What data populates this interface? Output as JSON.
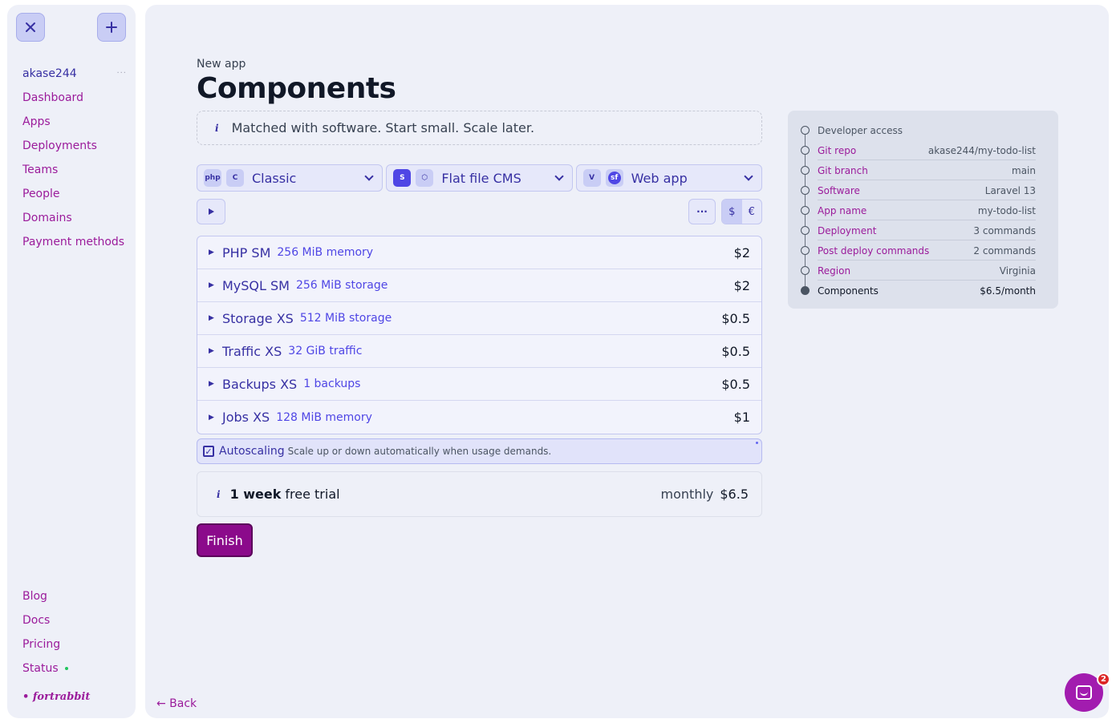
{
  "sidebar": {
    "user": "akase244",
    "user_menu": "···",
    "nav": [
      {
        "label": "Dashboard"
      },
      {
        "label": "Apps"
      },
      {
        "label": "Deployments"
      },
      {
        "label": "Teams"
      },
      {
        "label": "People"
      },
      {
        "label": "Domains"
      },
      {
        "label": "Payment methods"
      }
    ],
    "footer_links": [
      {
        "label": "Blog"
      },
      {
        "label": "Docs"
      },
      {
        "label": "Pricing"
      },
      {
        "label": "Status"
      }
    ],
    "brand": "• fortrabbit",
    "status_color": "#22c55e"
  },
  "header": {
    "breadcrumb": "New app",
    "title": "Components"
  },
  "info": {
    "icon": "i",
    "text": "Matched with software. Start small. Scale later."
  },
  "selects": [
    {
      "chips": [
        "php",
        "C"
      ],
      "label": "Classic"
    },
    {
      "chips": [
        "S",
        "⬡"
      ],
      "label": "Flat file CMS"
    },
    {
      "chips": [
        "V",
        "sf"
      ],
      "label": "Web app"
    }
  ],
  "toolbar": {
    "more_label": "···",
    "currencies": [
      "$",
      "€"
    ],
    "active_currency": "$"
  },
  "components": [
    {
      "name": "PHP SM",
      "detail": "256 MiB memory",
      "price": "$2"
    },
    {
      "name": "MySQL SM",
      "detail": "256 MiB storage",
      "price": "$2"
    },
    {
      "name": "Storage XS",
      "detail": "512 MiB storage",
      "price": "$0.5"
    },
    {
      "name": "Traffic XS",
      "detail": "32 GiB traffic",
      "price": "$0.5"
    },
    {
      "name": "Backups XS",
      "detail": "1 backups",
      "price": "$0.5"
    },
    {
      "name": "Jobs XS",
      "detail": "128 MiB memory",
      "price": "$1"
    }
  ],
  "autoscaling": {
    "checked": true,
    "label": "Autoscaling",
    "description": "Scale up or down automatically when usage demands."
  },
  "trial": {
    "icon": "i",
    "bold": "1 week",
    "rest": "free trial",
    "cycle": "monthly",
    "price": "$6.5"
  },
  "actions": {
    "finish": "Finish",
    "back": "← Back"
  },
  "summary": [
    {
      "label": "Developer access",
      "value": "",
      "state": "done-muted"
    },
    {
      "label": "Git repo",
      "value": "akase244/my-todo-list",
      "state": "done"
    },
    {
      "label": "Git branch",
      "value": "main",
      "state": "done"
    },
    {
      "label": "Software",
      "value": "Laravel 13",
      "state": "done"
    },
    {
      "label": "App name",
      "value": "my-todo-list",
      "state": "done"
    },
    {
      "label": "Deployment",
      "value": "3 commands",
      "state": "done"
    },
    {
      "label": "Post deploy commands",
      "value": "2 commands",
      "state": "done"
    },
    {
      "label": "Region",
      "value": "Virginia",
      "state": "done"
    },
    {
      "label": "Components",
      "value": "$6.5/month",
      "state": "current"
    }
  ],
  "chat": {
    "badge": "2"
  },
  "colors": {
    "accent": "#3730a3",
    "link": "#9b1b9b",
    "finish": "#8b0a8b",
    "panel": "#eef0f8"
  }
}
